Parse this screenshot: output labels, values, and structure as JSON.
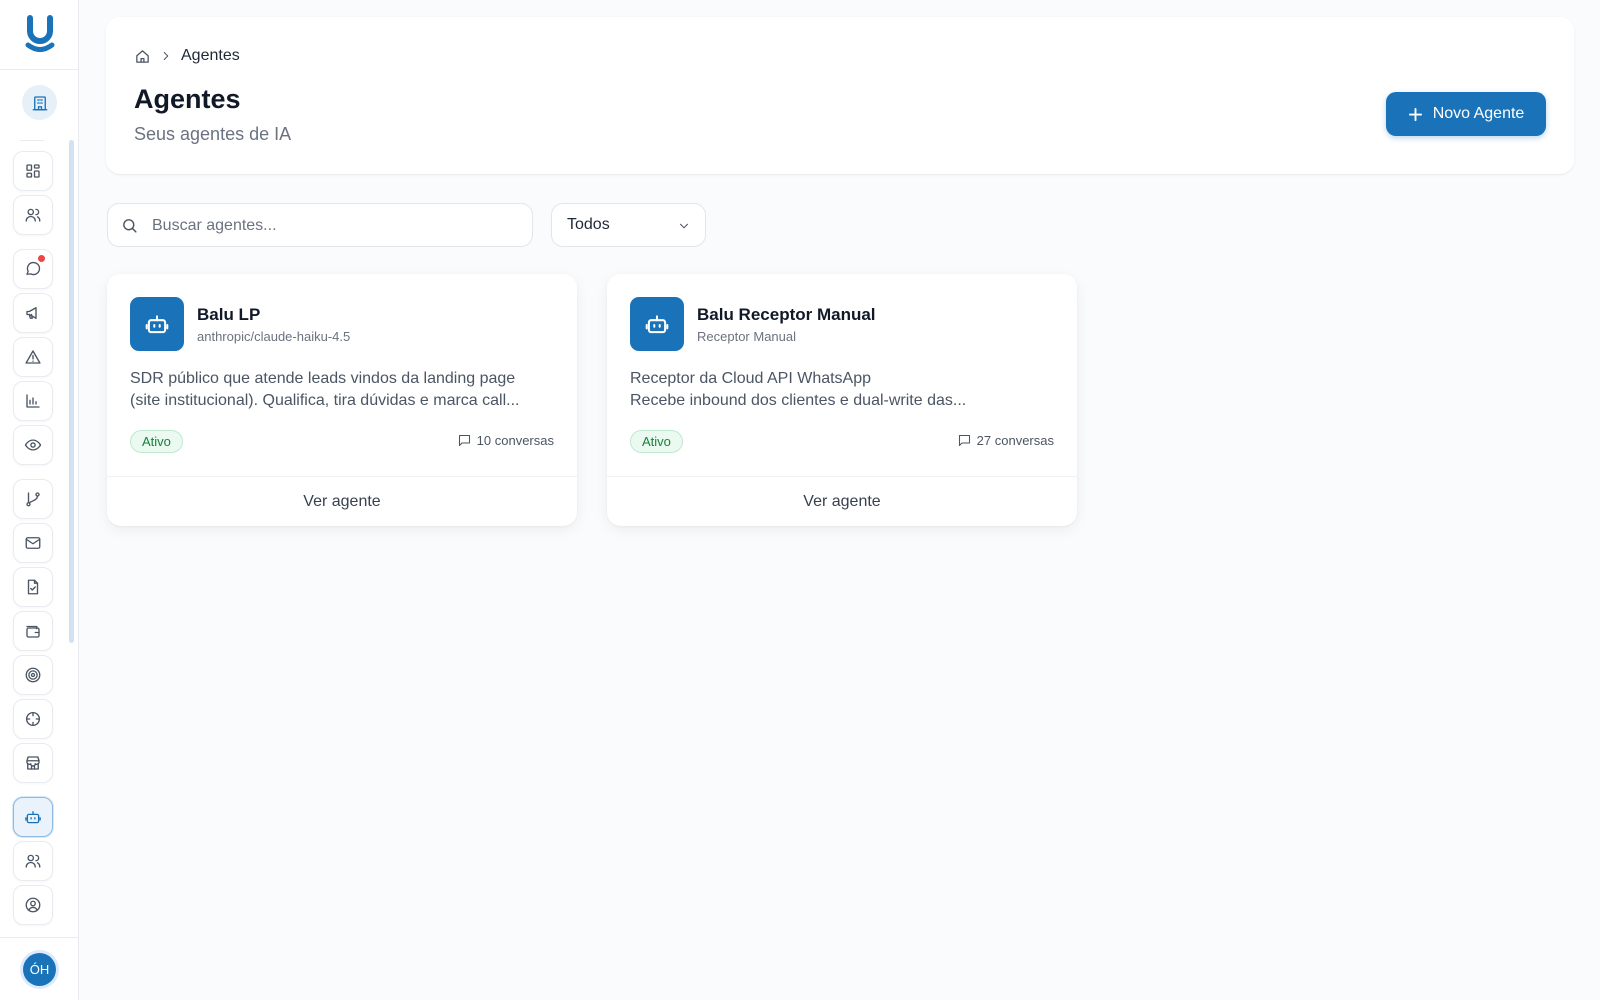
{
  "sidebar": {
    "logo_icon": "brand-u-logo",
    "org_icon": "building-icon",
    "items": [
      {
        "name": "dashboard",
        "icon": "grid-icon"
      },
      {
        "name": "contacts",
        "icon": "users-icon"
      },
      {
        "name": "conversations",
        "icon": "chat-icon",
        "has_notification": true
      },
      {
        "name": "campaigns",
        "icon": "megaphone-icon"
      },
      {
        "name": "alerts",
        "icon": "warning-icon"
      },
      {
        "name": "reports",
        "icon": "bar-chart-icon"
      },
      {
        "name": "monitoring",
        "icon": "eye-icon"
      },
      {
        "name": "flows",
        "icon": "git-branch-icon"
      },
      {
        "name": "email",
        "icon": "mail-icon"
      },
      {
        "name": "documents",
        "icon": "file-check-icon"
      },
      {
        "name": "wallet",
        "icon": "wallet-icon"
      },
      {
        "name": "goals",
        "icon": "target-icon"
      },
      {
        "name": "tracking",
        "icon": "crosshair-icon"
      },
      {
        "name": "store",
        "icon": "store-icon"
      },
      {
        "name": "agents",
        "icon": "bot-icon",
        "active": true
      },
      {
        "name": "team",
        "icon": "users-icon"
      },
      {
        "name": "profile",
        "icon": "user-circle-icon"
      }
    ],
    "avatar_initials": "ÓH"
  },
  "header": {
    "breadcrumb": {
      "home_icon": "home-icon",
      "separator_icon": "chevron-right-icon",
      "current": "Agentes"
    },
    "title": "Agentes",
    "subtitle": "Seus agentes de IA",
    "new_button_label": "Novo Agente"
  },
  "filters": {
    "search_placeholder": "Buscar agentes...",
    "search_value": "",
    "status_selected": "Todos"
  },
  "agents": [
    {
      "name": "Balu LP",
      "subtitle": "anthropic/claude-haiku-4.5",
      "description_lines": [
        "SDR público que atende leads vindos da landing page",
        "(site institucional). Qualifica, tira dúvidas e marca call..."
      ],
      "status": "Ativo",
      "conversations": "10 conversas",
      "action_label": "Ver agente"
    },
    {
      "name": "Balu Receptor Manual",
      "subtitle": "Receptor Manual",
      "description_lines": [
        "Receptor da Cloud API WhatsApp",
        "Recebe inbound dos clientes e dual-write das..."
      ],
      "status": "Ativo",
      "conversations": "27 conversas",
      "action_label": "Ver agente"
    }
  ],
  "colors": {
    "accent": "#1a73b8",
    "status_active_bg": "#eafaf0",
    "status_active_text": "#17803d",
    "notification": "#ef4444"
  }
}
